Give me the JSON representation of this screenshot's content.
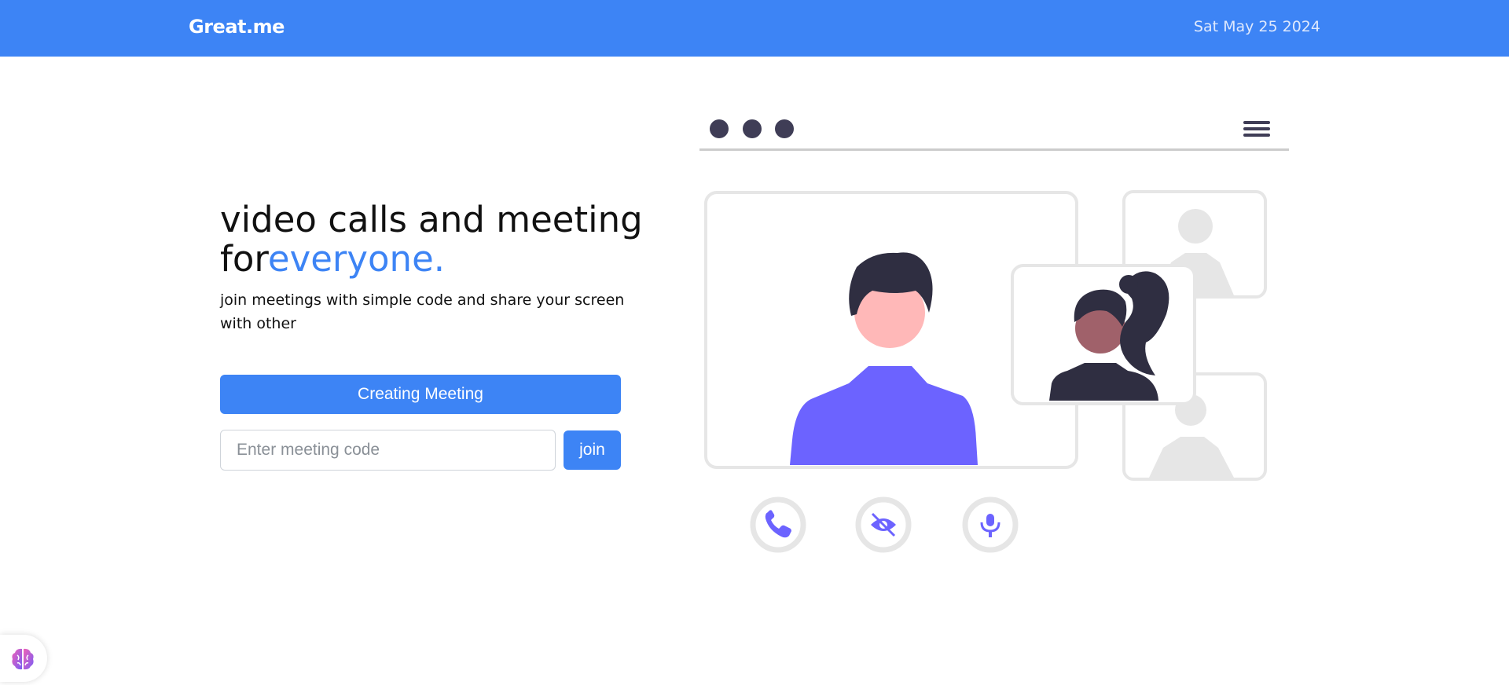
{
  "navbar": {
    "brand": "Great.me",
    "date": "Sat May 25 2024"
  },
  "hero": {
    "title_main": "video calls and meeting",
    "title_prefix": "for",
    "title_accent": "everyone.",
    "subtitle": "join meetings with simple code and share your screen with other"
  },
  "actions": {
    "create_label": "Creating Meeting",
    "code_placeholder": "Enter meeting code",
    "code_value": "",
    "join_label": "join"
  },
  "illustration": {
    "window_dots": 3,
    "controls": [
      "phone-icon",
      "eye-off-icon",
      "microphone-icon"
    ],
    "colors": {
      "accent": "#6c63ff",
      "dark": "#2f2e41",
      "skin_light": "#ffb8b8",
      "skin_dark": "#a0616a",
      "frame": "#e6e6e6"
    }
  },
  "widget": {
    "icon": "brain-icon"
  },
  "colors": {
    "primary": "#3d84f5",
    "text": "#111111"
  }
}
